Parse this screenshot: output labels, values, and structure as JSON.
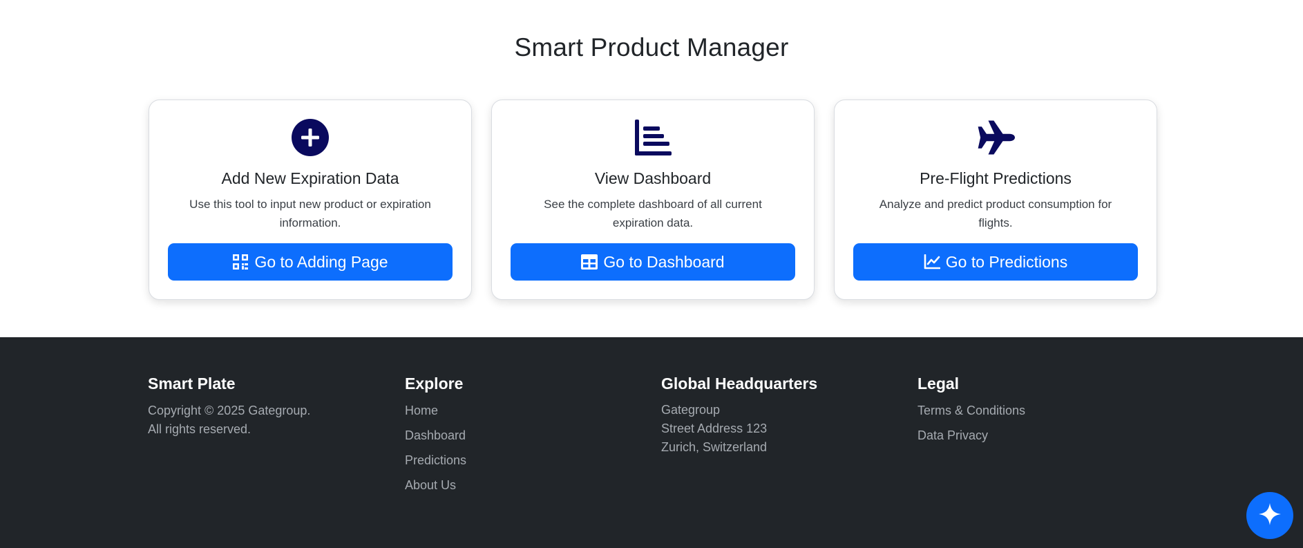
{
  "page": {
    "title": "Smart Product Manager"
  },
  "colors": {
    "accent": "#0d6efd",
    "icon_navy": "#0a0a5e",
    "footer_bg": "#212529"
  },
  "cards": [
    {
      "icon": "plus-circle-icon",
      "title": "Add New Expiration Data",
      "description": "Use this tool to input new product or expiration information.",
      "button_icon": "qr-code-icon",
      "button_label": "Go to Adding Page"
    },
    {
      "icon": "bar-chart-icon",
      "title": "View Dashboard",
      "description": "See the complete dashboard of all current expiration data.",
      "button_icon": "table-icon",
      "button_label": "Go to Dashboard"
    },
    {
      "icon": "airplane-icon",
      "title": "Pre-Flight Predictions",
      "description": "Analyze and predict product consumption for flights.",
      "button_icon": "line-chart-icon",
      "button_label": "Go to Predictions"
    }
  ],
  "footer": {
    "brand": {
      "title": "Smart Plate",
      "copyright_line1": "Copyright © 2025 Gategroup.",
      "copyright_line2": "All rights reserved."
    },
    "explore": {
      "title": "Explore",
      "links": [
        "Home",
        "Dashboard",
        "Predictions",
        "About Us"
      ]
    },
    "hq": {
      "title": "Global Headquarters",
      "lines": [
        "Gategroup",
        "Street Address 123",
        "Zurich, Switzerland"
      ]
    },
    "legal": {
      "title": "Legal",
      "links": [
        "Terms & Conditions",
        "Data Privacy"
      ]
    }
  },
  "fab": {
    "icon": "sparkle-icon"
  }
}
